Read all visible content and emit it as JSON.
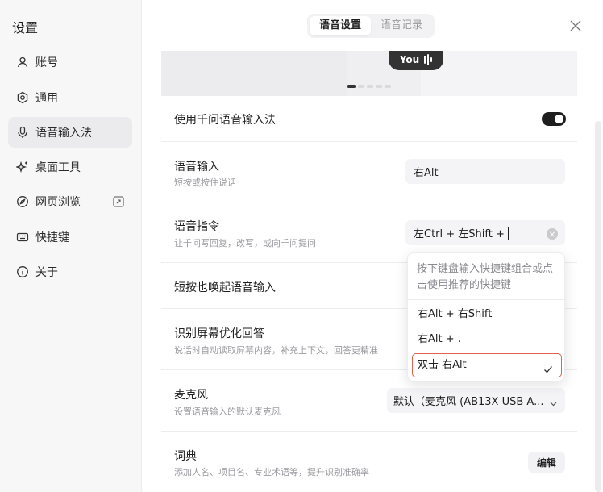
{
  "sidebar": {
    "title": "设置",
    "items": [
      {
        "label": "账号",
        "icon": "user-icon"
      },
      {
        "label": "通用",
        "icon": "settings-icon"
      },
      {
        "label": "语音输入法",
        "icon": "microphone-icon",
        "active": true
      },
      {
        "label": "桌面工具",
        "icon": "sparkle-icon"
      },
      {
        "label": "网页浏览",
        "icon": "compass-icon",
        "external_icon": "external-link-icon"
      },
      {
        "label": "快捷键",
        "icon": "keyboard-icon"
      },
      {
        "label": "关于",
        "icon": "info-icon"
      }
    ]
  },
  "tabs": [
    {
      "label": "语音设置",
      "active": true
    },
    {
      "label": "语音记录",
      "active": false
    }
  ],
  "preview": {
    "pill_label": "You"
  },
  "rows": {
    "use_qianwen": {
      "title": "使用千问语音输入法",
      "enabled": true
    },
    "voice_input": {
      "title": "语音输入",
      "subtitle": "短按或按住说话",
      "value": "右Alt"
    },
    "voice_command": {
      "title": "语音指令",
      "subtitle": "让千问写回复，改写，或向千问提问",
      "value": "左Ctrl + 左Shift +"
    },
    "short_press": {
      "title": "短按也唤起语音输入"
    },
    "screen_recognition": {
      "title": "识别屏幕优化回答",
      "subtitle": "说话时自动读取屏幕内容，补充上下文，回答更精准"
    },
    "microphone": {
      "title": "麦克风",
      "subtitle": "设置语音输入的默认麦克风",
      "value": "默认（麦克风 (AB13X USB A..."
    },
    "dictionary": {
      "title": "词典",
      "subtitle": "添加人名、项目名、专业术语等，提升识别准确率",
      "button": "编辑"
    }
  },
  "dropdown": {
    "hint": "按下键盘输入快捷键组合或点击使用推荐的快捷键",
    "options": [
      {
        "label": "右Alt + 右Shift",
        "selected": false
      },
      {
        "label": "右Alt + .",
        "selected": false
      },
      {
        "label": "双击 右Alt",
        "selected": true
      }
    ]
  },
  "colors": {
    "accent_border": "#e0644b",
    "toggle_on": "#1f1f1f"
  }
}
